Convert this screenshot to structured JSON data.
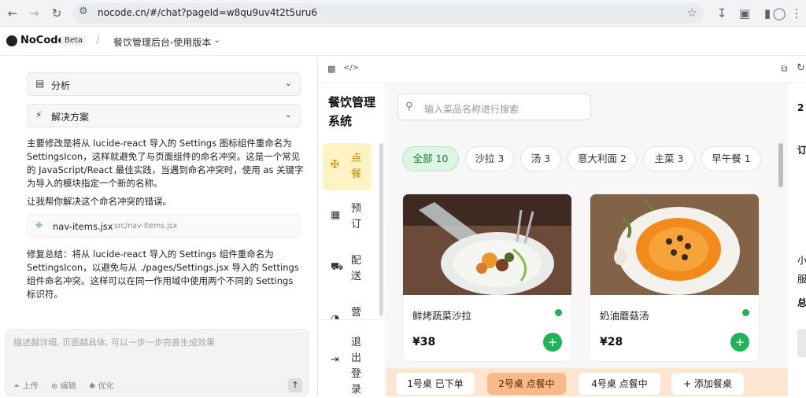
{
  "browser": {
    "url": "nocode.cn/#/chat?pageId=w8qu9uv4t2t5uru6"
  },
  "app": {
    "brand": "NoCode",
    "badge": "Beta",
    "separator": "/",
    "page_title": "餐饮管理后台-使用版本"
  },
  "chat": {
    "accordions": [
      {
        "label": "分析"
      },
      {
        "label": "解决方案"
      }
    ],
    "p1": "主要修改是将从 lucide-react 导入的 Settings 图标组件重命名为 SettingsIcon，这样就避免了与页面组件的命名冲突。这是一个常见的 JavaScript/React 最佳实践，当遇到命名冲突时，使用 as 关键字为导入的模块指定一个新的名称。",
    "p2": "让我帮你解决这个命名冲突的错误。",
    "file": {
      "name": "nav-items.jsx",
      "path": "src/nav-items.jsx"
    },
    "p3": "修复总结：将从 lucide-react 导入的 Settings 组件重命名为 SettingsIcon，以避免与从 ./pages/Settings.jsx 导入的 Settings 组件命名冲突。这样可以在同一作用域中使用两个不同的 Settings 标识符。",
    "composer": {
      "placeholder": "描述越详细, 页面越具体, 可以一步一步完善生成效果",
      "upload": "上传",
      "edit": "编辑",
      "optimize": "优化"
    }
  },
  "preview": {
    "system_name": "餐饮管理系统",
    "nav": [
      {
        "label": "点餐",
        "icon": "utensils-icon",
        "active": true
      },
      {
        "label": "预订",
        "icon": "calendar-icon",
        "active": false
      },
      {
        "label": "配送",
        "icon": "truck-icon",
        "active": false
      },
      {
        "label": "营业",
        "icon": "chart-icon",
        "active": false
      }
    ],
    "logout": "退出登录",
    "search_placeholder": "输入菜品名称进行搜索",
    "categories": [
      "全部 10",
      "沙拉 3",
      "汤 3",
      "意大利面 2",
      "主菜 3",
      "早午餐 1"
    ],
    "dishes": [
      {
        "name": "鲜烤蔬菜沙拉",
        "price": "¥38"
      },
      {
        "name": "奶油蘑菇汤",
        "price": "¥28"
      }
    ],
    "tables": [
      "1号桌 已下单",
      "2号桌 点餐中",
      "4号桌 点餐中",
      "+ 添加餐桌"
    ],
    "right_panel": {
      "t1": "2",
      "t2": "订",
      "t3": "小",
      "t4": "服",
      "t5": "总"
    },
    "colors": {
      "accent_green": "#21b35a",
      "active_nav": "#fff3c4",
      "table_bar": "#fde5cf"
    }
  }
}
